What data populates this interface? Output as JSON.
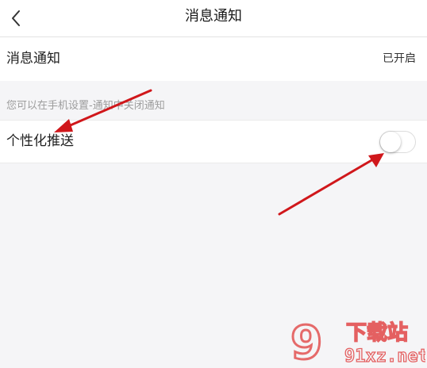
{
  "header": {
    "title": "消息通知",
    "back_icon": "chevron-left-icon"
  },
  "settings": {
    "notify_label": "消息通知",
    "notify_value": "已开启",
    "hint": "您可以在手机设置-通知中关闭通知",
    "personal_label": "个性化推送",
    "personal_enabled": false
  },
  "watermark": {
    "logo_text": "9",
    "site_name": "下载站",
    "site_url": "91xz.net"
  },
  "colors": {
    "arrow": "#d0171b",
    "watermark": "#e03c3c",
    "background": "#f5f5f7"
  }
}
